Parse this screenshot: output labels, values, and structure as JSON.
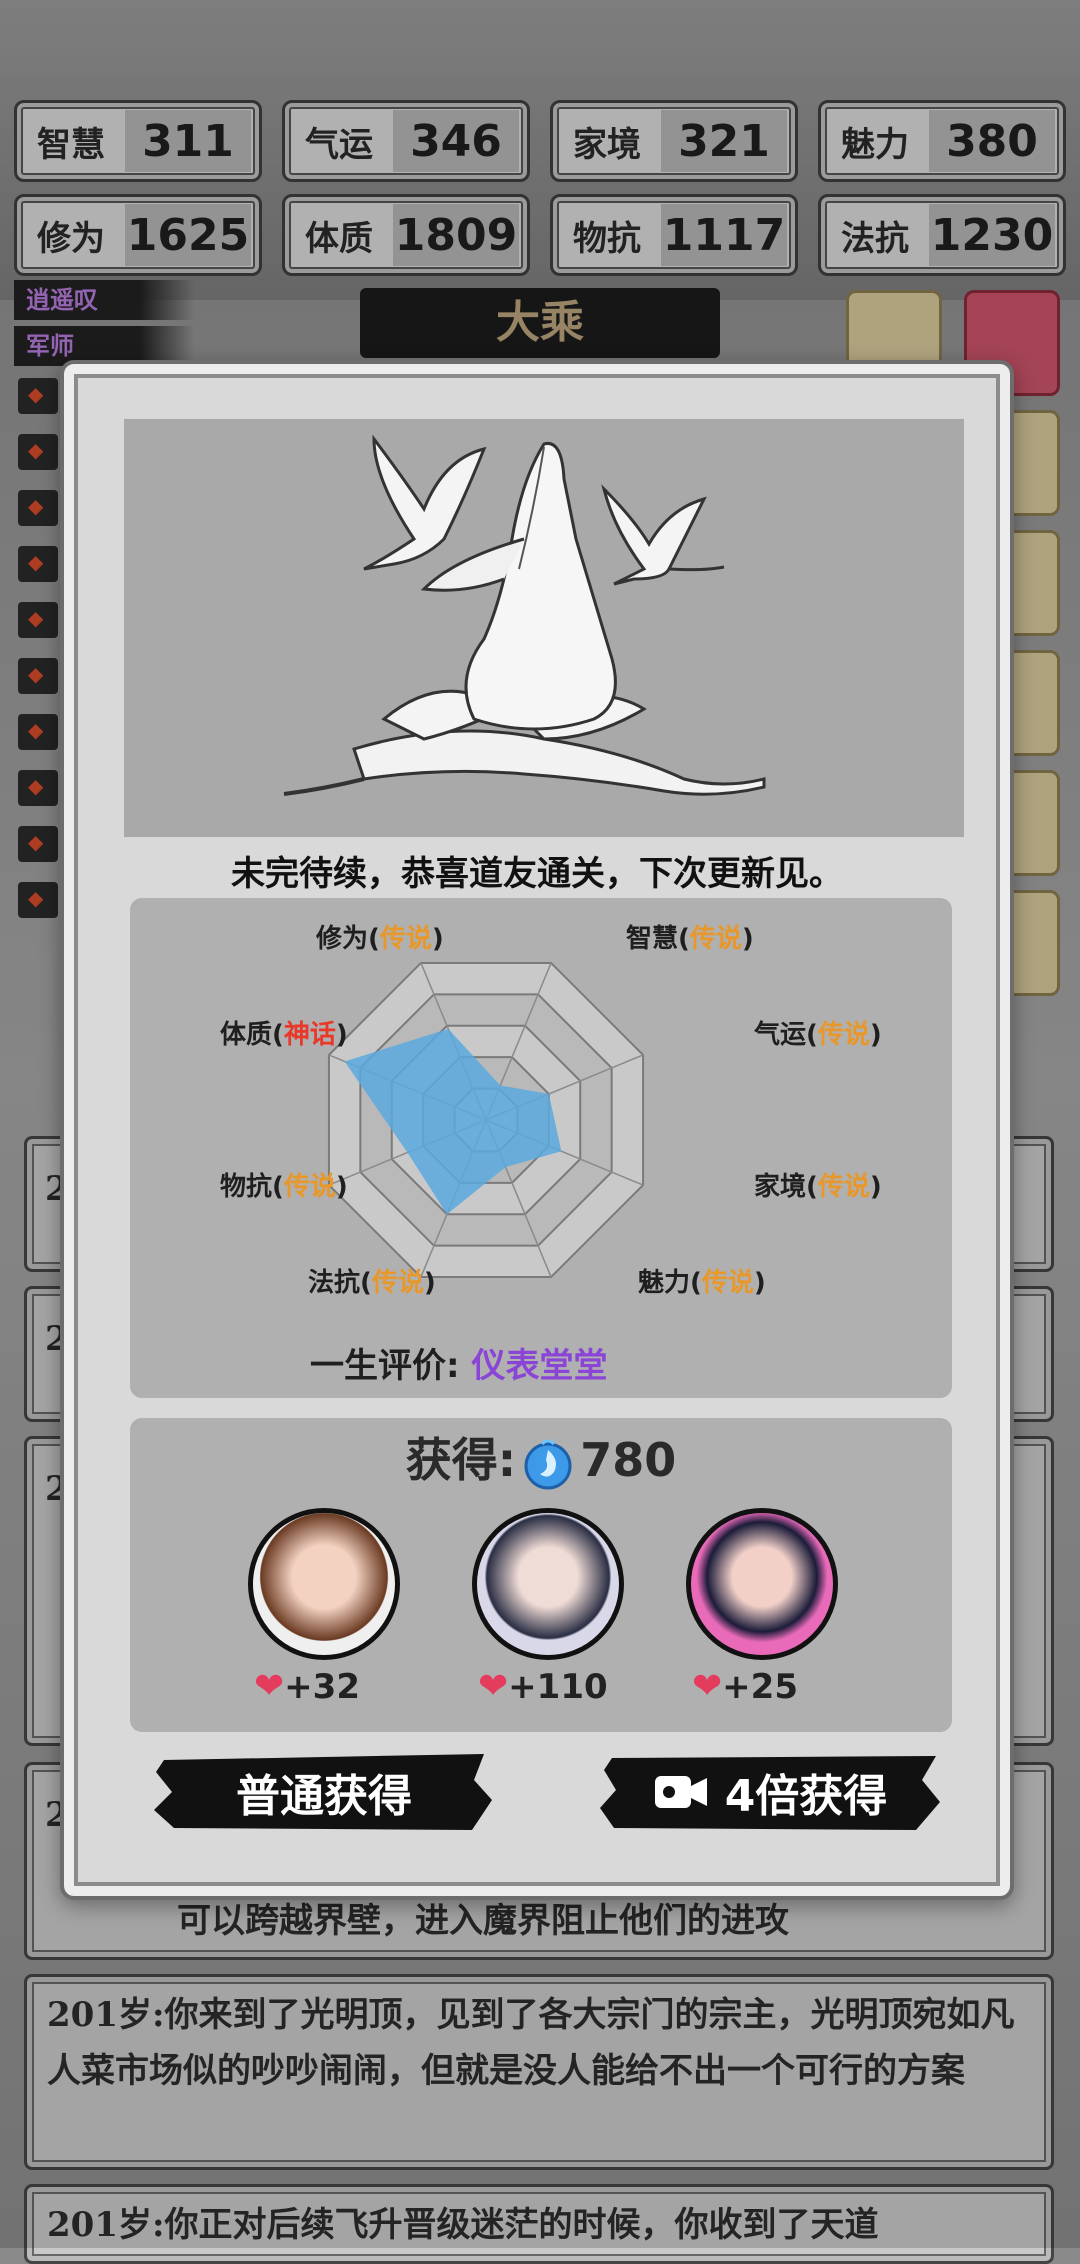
{
  "stats": [
    {
      "label": "智慧",
      "value": "311"
    },
    {
      "label": "气运",
      "value": "346"
    },
    {
      "label": "家境",
      "value": "321"
    },
    {
      "label": "魅力",
      "value": "380"
    },
    {
      "label": "修为",
      "value": "1625"
    },
    {
      "label": "体质",
      "value": "1809"
    },
    {
      "label": "物抗",
      "value": "1117"
    },
    {
      "label": "法抗",
      "value": "1230"
    }
  ],
  "realm": "大乘",
  "side_tags": [
    "逍遥叹",
    "军师"
  ],
  "modal": {
    "message": "未完待续，恭喜道友通关，下次更新见。",
    "radar": {
      "axes": [
        {
          "name": "修为",
          "grade": "传说",
          "value": 0.58
        },
        {
          "name": "智慧",
          "grade": "传说",
          "value": 0.22
        },
        {
          "name": "气运",
          "grade": "传说",
          "value": 0.4
        },
        {
          "name": "家境",
          "grade": "传说",
          "value": 0.48
        },
        {
          "name": "魅力",
          "grade": "传说",
          "value": 0.3
        },
        {
          "name": "法抗",
          "grade": "传说",
          "value": 0.6
        },
        {
          "name": "物抗",
          "grade": "传说",
          "value": 0.5
        },
        {
          "name": "体质",
          "grade": "神话",
          "value": 0.9
        }
      ],
      "fill_color": "#5aa8de"
    },
    "evaluation_label": "一生评价:",
    "evaluation_value": "仪表堂堂",
    "reward_label": "获得:",
    "reward_amount": "780",
    "companions": [
      {
        "bonus": "+32"
      },
      {
        "bonus": "+110"
      },
      {
        "bonus": "+25"
      }
    ],
    "buttons": {
      "normal": "普通获得",
      "video": "4倍获得"
    }
  },
  "log": [
    {
      "age": "2",
      "text": ""
    },
    {
      "age": "2",
      "text": ""
    },
    {
      "age": "2",
      "text": ""
    },
    {
      "age": "2",
      "text": ""
    },
    {
      "age": "",
      "text": "可以跨越界壁，进入魔界阻止他们的进攻"
    },
    {
      "age": "201岁:",
      "text": "你来到了光明顶，见到了各大宗门的宗主，光明顶宛如凡人菜市场似的吵吵闹闹，但就是没人能给不出一个可行的方案"
    },
    {
      "age": "201岁:",
      "text": "你正对后续飞升晋级迷茫的时候，你收到了天道"
    }
  ]
}
